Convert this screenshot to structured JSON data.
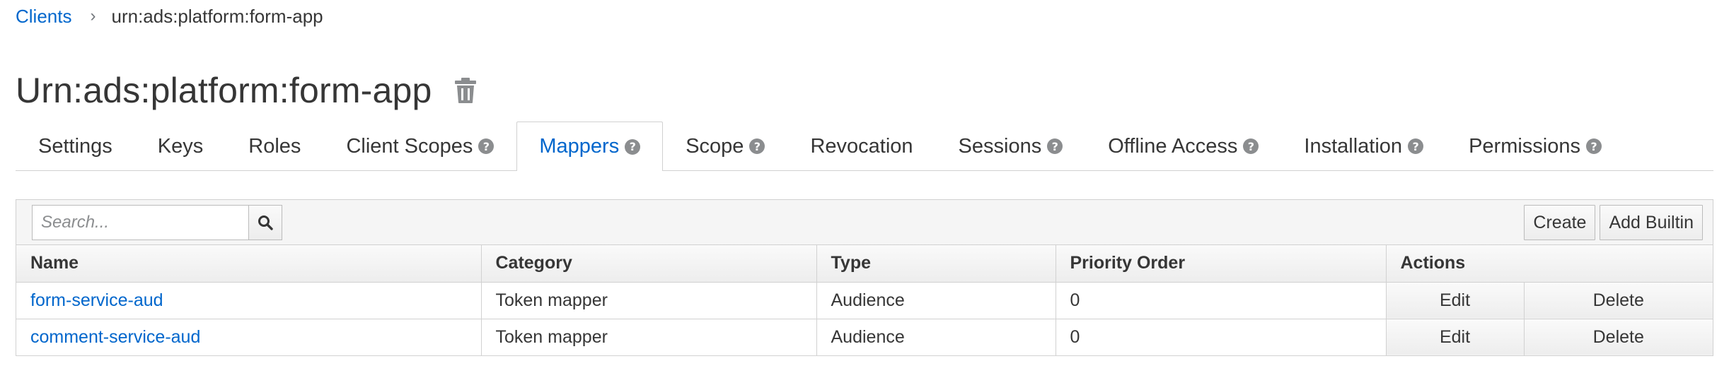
{
  "breadcrumb": {
    "parent": "Clients",
    "current": "urn:ads:platform:form-app"
  },
  "title": "Urn:ads:platform:form-app",
  "tabs": [
    {
      "label": "Settings",
      "help": false,
      "active": false
    },
    {
      "label": "Keys",
      "help": false,
      "active": false
    },
    {
      "label": "Roles",
      "help": false,
      "active": false
    },
    {
      "label": "Client Scopes",
      "help": true,
      "active": false
    },
    {
      "label": "Mappers",
      "help": true,
      "active": true
    },
    {
      "label": "Scope",
      "help": true,
      "active": false
    },
    {
      "label": "Revocation",
      "help": false,
      "active": false
    },
    {
      "label": "Sessions",
      "help": true,
      "active": false
    },
    {
      "label": "Offline Access",
      "help": true,
      "active": false
    },
    {
      "label": "Installation",
      "help": true,
      "active": false
    },
    {
      "label": "Permissions",
      "help": true,
      "active": false
    }
  ],
  "search": {
    "placeholder": "Search...",
    "value": ""
  },
  "toolbar": {
    "create_label": "Create",
    "add_builtin_label": "Add Builtin"
  },
  "table": {
    "headers": [
      "Name",
      "Category",
      "Type",
      "Priority Order",
      "Actions"
    ],
    "rows": [
      {
        "name": "form-service-aud",
        "category": "Token mapper",
        "type": "Audience",
        "priority": "0",
        "edit": "Edit",
        "delete": "Delete"
      },
      {
        "name": "comment-service-aud",
        "category": "Token mapper",
        "type": "Audience",
        "priority": "0",
        "edit": "Edit",
        "delete": "Delete"
      }
    ]
  },
  "colors": {
    "link": "#0066cc",
    "text": "#363636",
    "border": "#d1d1d1",
    "icon": "#8b8d8f"
  },
  "icons": {
    "trash": "trash-icon",
    "help": "help-icon",
    "search": "search-icon",
    "breadcrumb_separator": "chevron-right-icon"
  }
}
